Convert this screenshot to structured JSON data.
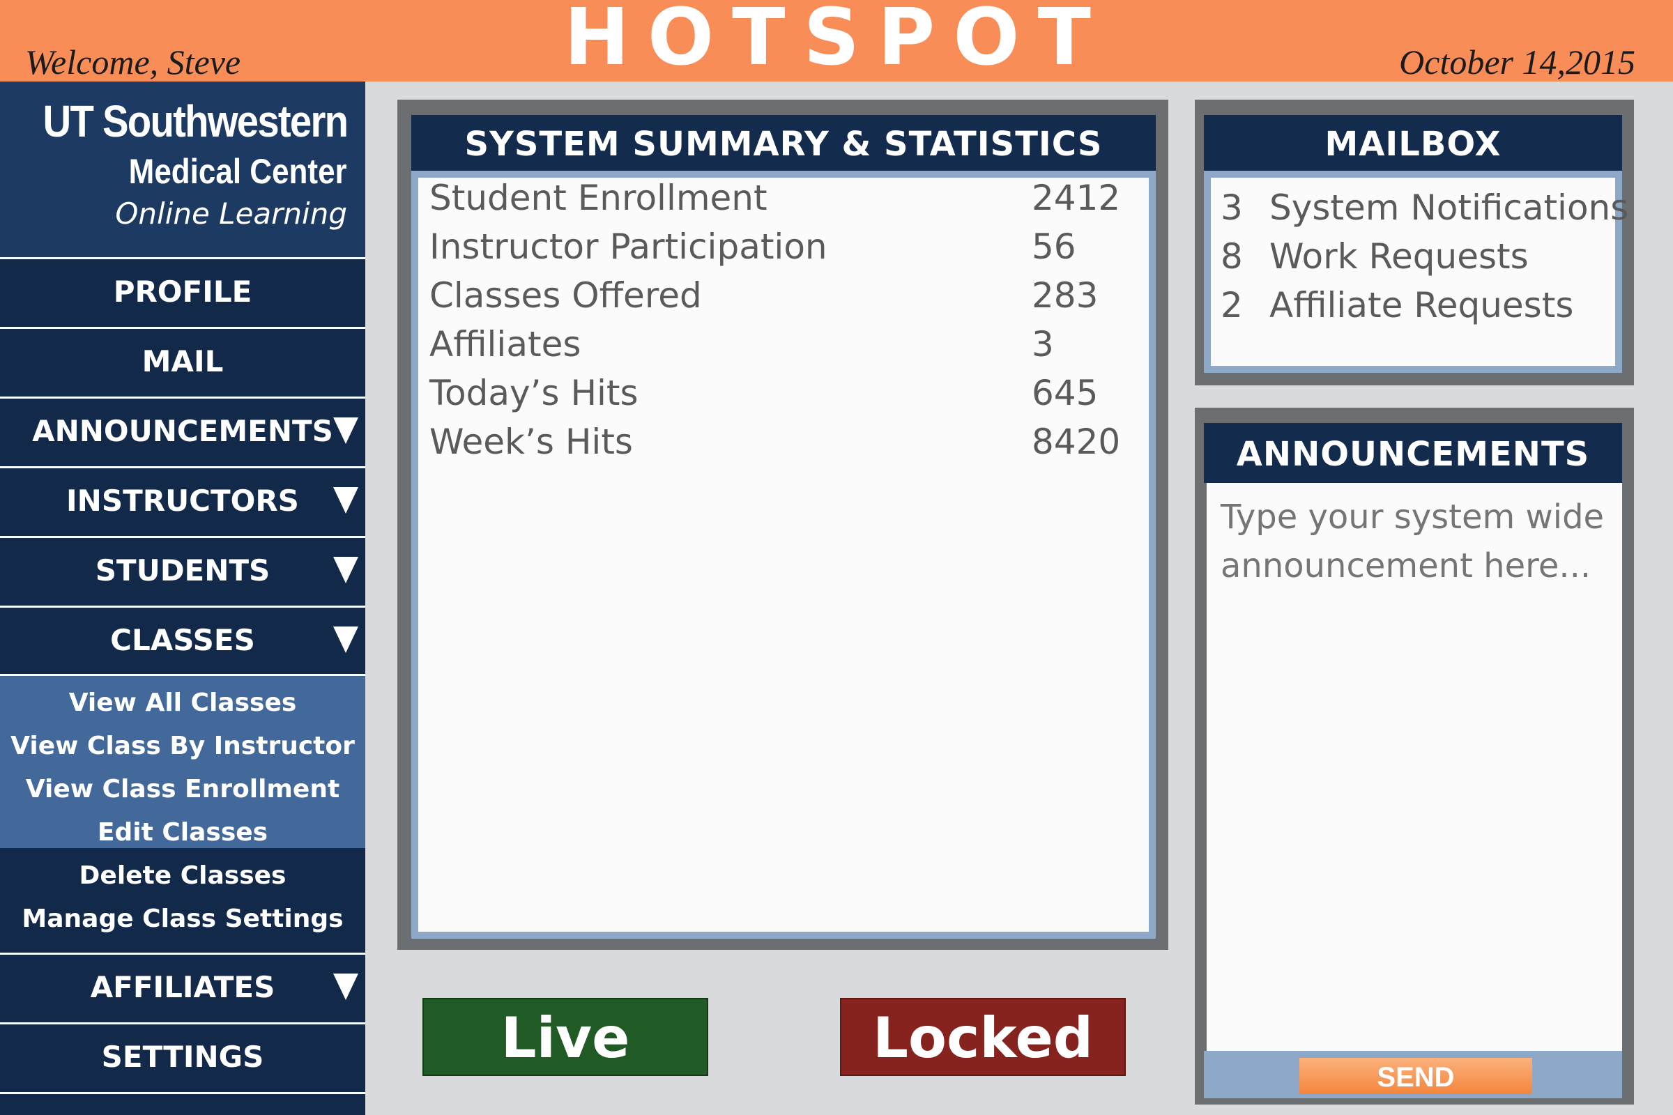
{
  "header": {
    "welcome": "Welcome, Steve",
    "brand": "HOTSPOT",
    "date": "October 14,2015"
  },
  "sidebar": {
    "logo": {
      "line1": "UT Southwestern",
      "line2": "Medical Center",
      "line3": "Online Learning"
    },
    "items": [
      {
        "label": "PROFILE",
        "has_arrow": false
      },
      {
        "label": "MAIL",
        "has_arrow": false
      },
      {
        "label": "ANNOUNCEMENTS",
        "has_arrow": true
      },
      {
        "label": "INSTRUCTORS",
        "has_arrow": true
      },
      {
        "label": "STUDENTS",
        "has_arrow": true
      },
      {
        "label": "CLASSES",
        "has_arrow": true
      },
      {
        "label": "AFFILIATES",
        "has_arrow": true
      },
      {
        "label": "SETTINGS",
        "has_arrow": false
      }
    ],
    "classes_submenu": [
      "View All Classes",
      "View Class By Instructor",
      "View Class Enrollment",
      "Edit Classes",
      "Delete Classes",
      "Manage Class Settings"
    ]
  },
  "stats": {
    "title": "SYSTEM SUMMARY & STATISTICS",
    "rows": [
      {
        "label": "Student Enrollment",
        "value": "2412"
      },
      {
        "label": "Instructor Participation",
        "value": "56"
      },
      {
        "label": "Classes Offered",
        "value": "283"
      },
      {
        "label": "Affiliates",
        "value": "3"
      },
      {
        "label": "Today’s Hits",
        "value": "645"
      },
      {
        "label": "Week’s Hits",
        "value": "8420"
      }
    ]
  },
  "mailbox": {
    "title": "MAILBOX",
    "rows": [
      {
        "count": "3",
        "label": "System Notifications"
      },
      {
        "count": "8",
        "label": "Work Requests"
      },
      {
        "count": "2",
        "label": "Affiliate Requests"
      }
    ]
  },
  "announcements": {
    "title": "ANNOUNCEMENTS",
    "placeholder": "Type your system wide announcement here...",
    "send_label": "SEND"
  },
  "status": {
    "live_label": "Live",
    "locked_label": "Locked"
  },
  "colors": {
    "topbar": "#f98d57",
    "navy": "#12294a",
    "submenu": "#43699a",
    "live": "#205a25",
    "locked": "#87231f",
    "send": "#f4853d"
  }
}
